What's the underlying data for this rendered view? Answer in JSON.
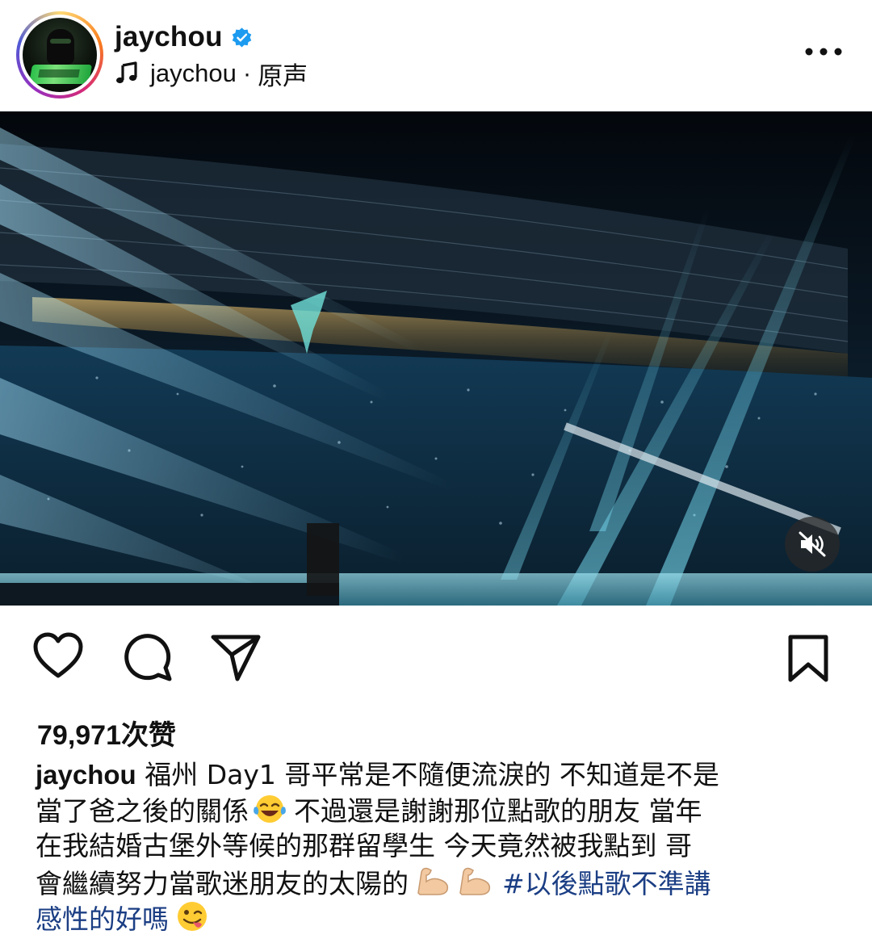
{
  "post": {
    "username": "jaychou",
    "verified": true,
    "audio": {
      "artist": "jaychou",
      "separator": "·",
      "track": "原声"
    },
    "media": {
      "type": "video",
      "muted": true
    },
    "likes_text": "79,971次赞",
    "caption": {
      "username": "jaychou",
      "lines": [
        "福州 Day1 哥平常是不隨便流淚的 不知道是不是",
        "當了爸之後的關係",
        "不過還是謝謝那位點歌的朋友 當年",
        "在我結婚古堡外等候的那群留學生  今天竟然被我點到 哥",
        "會繼續努力當歌迷朋友的太陽的",
        "#以後點歌不準講",
        "感性的好嗎"
      ],
      "hashtag": "#以後點歌不準講感性的好嗎",
      "emojis": [
        "face-with-tears-of-joy",
        "flexed-biceps",
        "flexed-biceps",
        "winking-face-with-tongue"
      ]
    }
  },
  "colors": {
    "verified": "#1d9bf0",
    "hashtag": "#1b3e84",
    "text": "#111111"
  },
  "icons": [
    "verified-icon",
    "music-note-icon",
    "more-icon",
    "mute-icon",
    "heart-icon",
    "comment-icon",
    "share-icon",
    "bookmark-icon"
  ]
}
